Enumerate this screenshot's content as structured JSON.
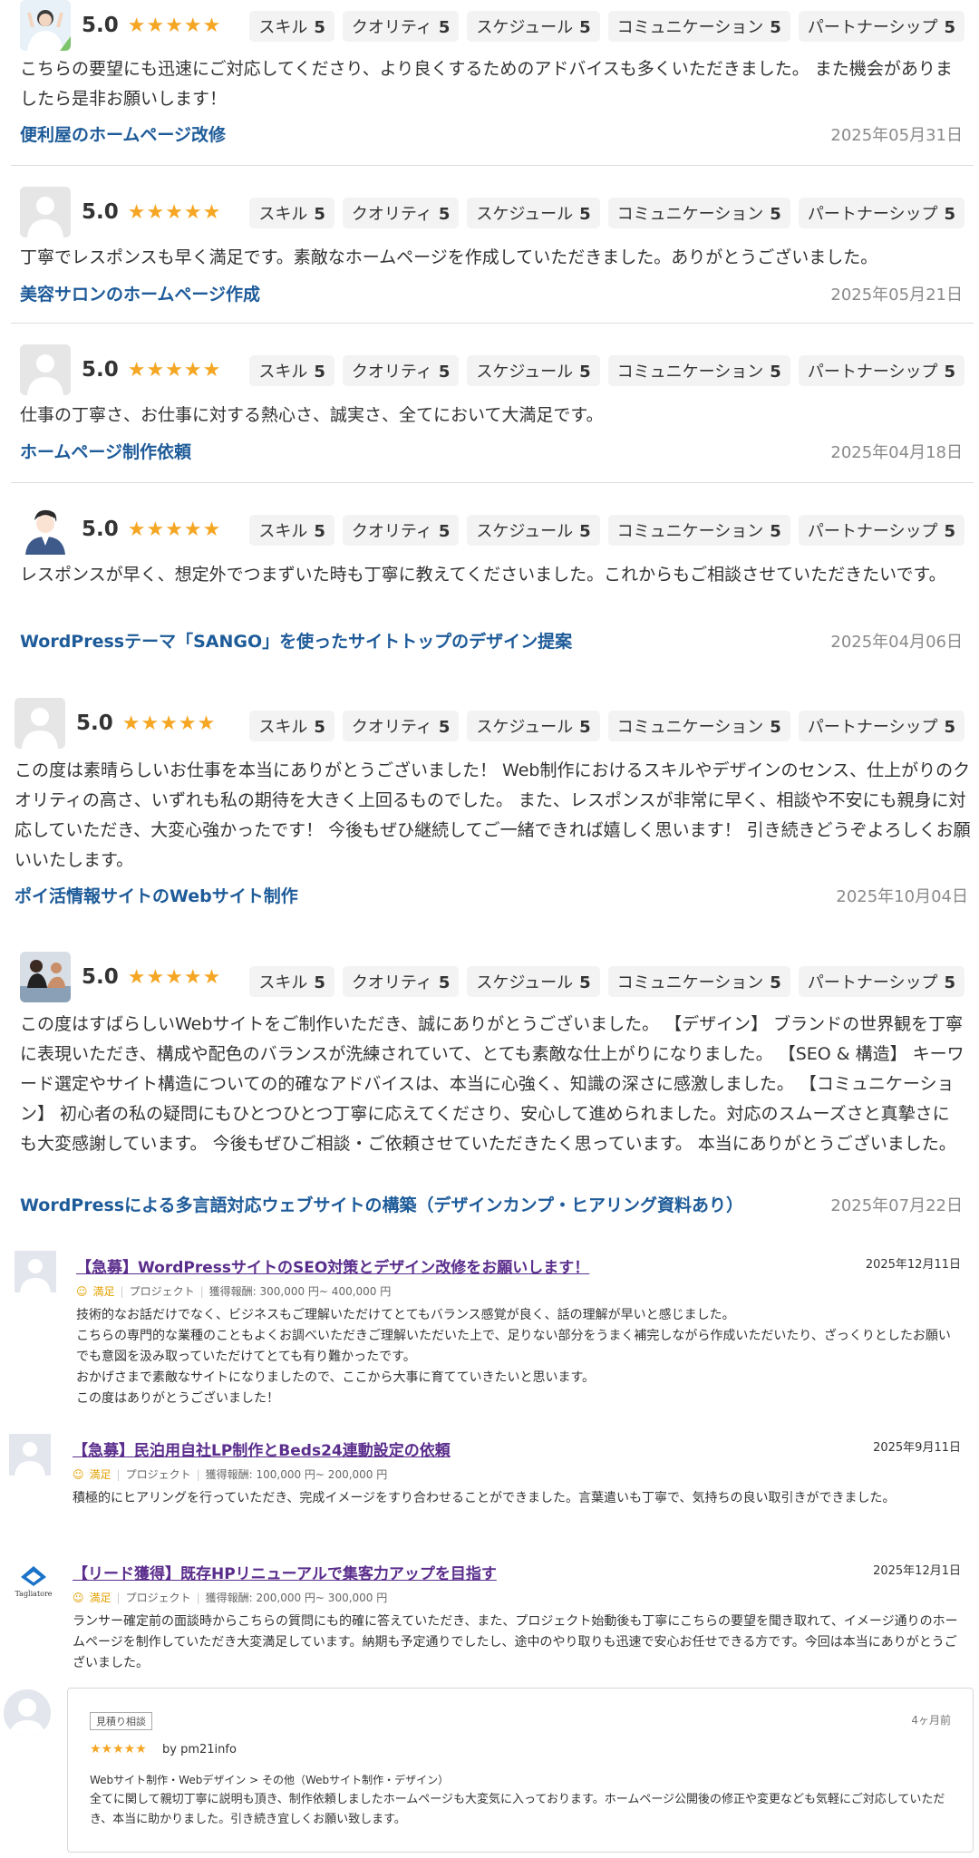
{
  "score_chip_labels": [
    "スキル",
    "クオリティ",
    "スケジュール",
    "コミュニケーション",
    "パートナーシップ"
  ],
  "reviews": [
    {
      "score": "5.0",
      "stars": "★★★★★",
      "chip_values": [
        "5",
        "5",
        "5",
        "5",
        "5"
      ],
      "text": "こちらの要望にも迅速にご対応してくださり、より良くするためのアドバイスも多くいただきました。 また機会がありましたら是非お願いします！",
      "title": "便利屋のホームページ改修",
      "date": "2025年05月31日",
      "avatar_icon": "woman-photo-icon"
    },
    {
      "score": "5.0",
      "stars": "★★★★★",
      "chip_values": [
        "5",
        "5",
        "5",
        "5",
        "5"
      ],
      "text": "丁寧でレスポンスも早く満足です。素敵なホームページを作成していただきました。ありがとうございました。",
      "title": "美容サロンのホームページ作成",
      "date": "2025年05月21日",
      "avatar_icon": "default-user-icon"
    },
    {
      "score": "5.0",
      "stars": "★★★★★",
      "chip_values": [
        "5",
        "5",
        "5",
        "5",
        "5"
      ],
      "text": "仕事の丁寧さ、お仕事に対する熱心さ、誠実さ、全てにおいて大満足です。",
      "title": "ホームページ制作依頼",
      "date": "2025年04月18日",
      "avatar_icon": "default-user-icon"
    },
    {
      "score": "5.0",
      "stars": "★★★★★",
      "chip_values": [
        "5",
        "5",
        "5",
        "5",
        "5"
      ],
      "text": "レスポンスが早く、想定外でつまずいた時も丁寧に教えてくださいました。これからもご相談させていただきたいです。",
      "title": "WordPressテーマ「SANGO」を使ったサイトトップのデザイン提案",
      "date": "2025年04月06日",
      "avatar_icon": "man-illustration-icon"
    },
    {
      "score": "5.0",
      "stars": "★★★★★",
      "chip_values": [
        "5",
        "5",
        "5",
        "5",
        "5"
      ],
      "text": "この度は素晴らしいお仕事を本当にありがとうございました！ Web制作におけるスキルやデザインのセンス、仕上がりのクオリティの高さ、いずれも私の期待を大きく上回るものでした。 また、レスポンスが非常に早く、相談や不安にも親身に対応していただき、大変心強かったです！ 今後もぜひ継続してご一緒できれば嬉しく思います！ 引き続きどうぞよろしくお願いいたします。",
      "title": "ポイ活情報サイトのWebサイト制作",
      "date": "2025年10月04日",
      "avatar_icon": "default-user-icon"
    },
    {
      "score": "5.0",
      "stars": "★★★★★",
      "chip_values": [
        "5",
        "5",
        "5",
        "5",
        "5"
      ],
      "text": "この度はすばらしいWebサイトをご制作いただき、誠にありがとうございました。 【デザイン】 ブランドの世界観を丁寧に表現いただき、構成や配色のバランスが洗練されていて、とても素敵な仕上がりになりました。 【SEO & 構造】 キーワード選定やサイト構造についての的確なアドバイスは、本当に心強く、知識の深さに感激しました。 【コミュニケーション】 初心者の私の疑問にもひとつひとつ丁寧に応えてくださり、安心して進められました。対応のスムーズさと真摯さにも大変感謝しています。 今後もぜひご相談・ご依頼させていただきたく思っています。 本当にありがとうございました。",
      "title": "WordPressによる多言語対応ウェブサイトの構築（デザインカンプ・ヒアリング資料あり）",
      "date": "2025年07月22日",
      "avatar_icon": "massage-photo-icon"
    }
  ],
  "lancers": [
    {
      "title": "【急募】WordPressサイトのSEO対策とデザイン改修をお願いします！",
      "date": "2025年12月11日",
      "satisfaction": "満足",
      "type": "プロジェクト",
      "reward": "獲得報酬: 300,000 円~ 400,000 円",
      "body_lines": [
        "技術的なお話だけでなく、ビジネスもご理解いただけてとてもバランス感覚が良く、話の理解が早いと感じました。",
        "こちらの専門的な業種のこともよくお調べいただきご理解いただいた上で、足りない部分をうまく補完しながら作成いただいたり、ざっくりとしたお願いでも意図を汲み取っていただけてとても有り難かったです。",
        "おかげさまで素敵なサイトになりましたので、ここから大事に育てていきたいと思います。",
        "この度はありがとうございました！"
      ],
      "avatar_icon": "default-user-icon"
    },
    {
      "title": "【急募】民泊用自社LP制作とBeds24連動設定の依頼",
      "date": "2025年9月11日",
      "satisfaction": "満足",
      "type": "プロジェクト",
      "reward": "獲得報酬: 100,000 円~ 200,000 円",
      "body_lines": [
        "積極的にヒアリングを行っていただき、完成イメージをすり合わせることができました。言葉遣いも丁寧で、気持ちの良い取引きができました。"
      ],
      "avatar_icon": "default-user-icon"
    },
    {
      "title": "【リード獲得】既存HPリニューアルで集客力アップを目指す",
      "date": "2025年12月1日",
      "satisfaction": "満足",
      "type": "プロジェクト",
      "reward": "獲得報酬: 200,000 円~ 300,000 円",
      "body_lines": [
        "ランサー確定前の面談時からこちらの質問にも的確に答えていただき、また、プロジェクト始動後も丁寧にこちらの要望を聞き取れて、イメージ通りのホームページを制作していただき大変満足しています。納期も予定通りでしたし、途中のやり取りも迅速で安心お任せできる方です。今回は本当にありがとうございました。"
      ],
      "avatar_icon": "tagliatore-logo-icon",
      "logo_text": "Tagliatore"
    }
  ],
  "coconala": {
    "badge": "見積り相談",
    "ago": "4ヶ月前",
    "stars": "★★★★★",
    "by": "by pm21info",
    "category": "Webサイト制作・Webデザイン > その他（Webサイト制作・デザイン）",
    "text": "全てに関して親切丁寧に説明も頂き、制作依頼しましたホームページも大変気に入っております。ホームページ公開後の修正や変更なども気軽にご対応していただき、本当に助かりました。引き続き宜しくお願い致します。"
  },
  "colors": {
    "title_blue": "#1e5b99",
    "lancers_purple": "#5a2d8c",
    "star_orange": "#f5a623"
  }
}
